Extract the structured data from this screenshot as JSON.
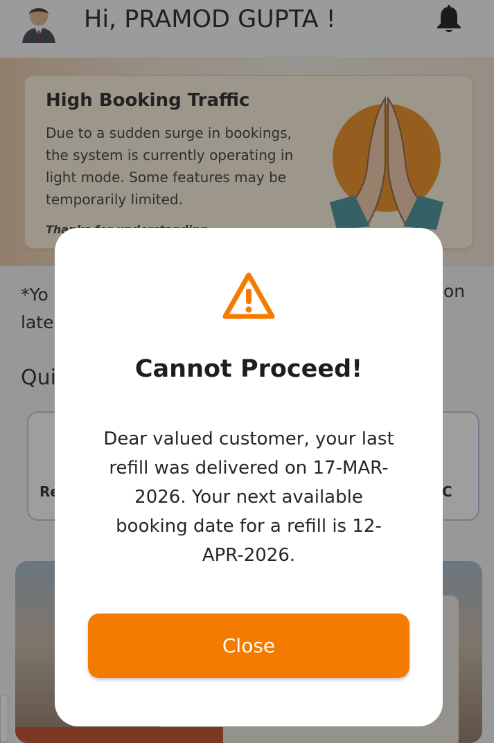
{
  "header": {
    "greeting": "Hi, PRAMOD GUPTA !"
  },
  "notice": {
    "title": "High Booking Traffic",
    "body": "Due to a sudden surge in bookings, the system is currently operating in light mode. Some features may be temporarily limited.",
    "thanks_partial": "Thanks for understanding"
  },
  "background": {
    "info_text_left": "*Yo",
    "info_text_left_line2": "late",
    "info_text_right": "on",
    "section_title_partial": "Qui",
    "quick_card_left_label_partial": "Re",
    "quick_card_right_label_partial": "C"
  },
  "modal": {
    "title": "Cannot Proceed!",
    "message": "Dear valued customer, your last refill was delivered on 17-MAR-2026. Your next available booking date for a refill is 12-APR-2026.",
    "close_label": "Close"
  },
  "colors": {
    "accent": "#f47a00",
    "warning_icon": "#f47a00",
    "notice_bg": "#fbf1dc"
  },
  "icons": {
    "avatar": "user-avatar",
    "bell": "bell-icon",
    "warning": "warning-triangle-icon",
    "namaste": "namaste-hands-illustration"
  }
}
